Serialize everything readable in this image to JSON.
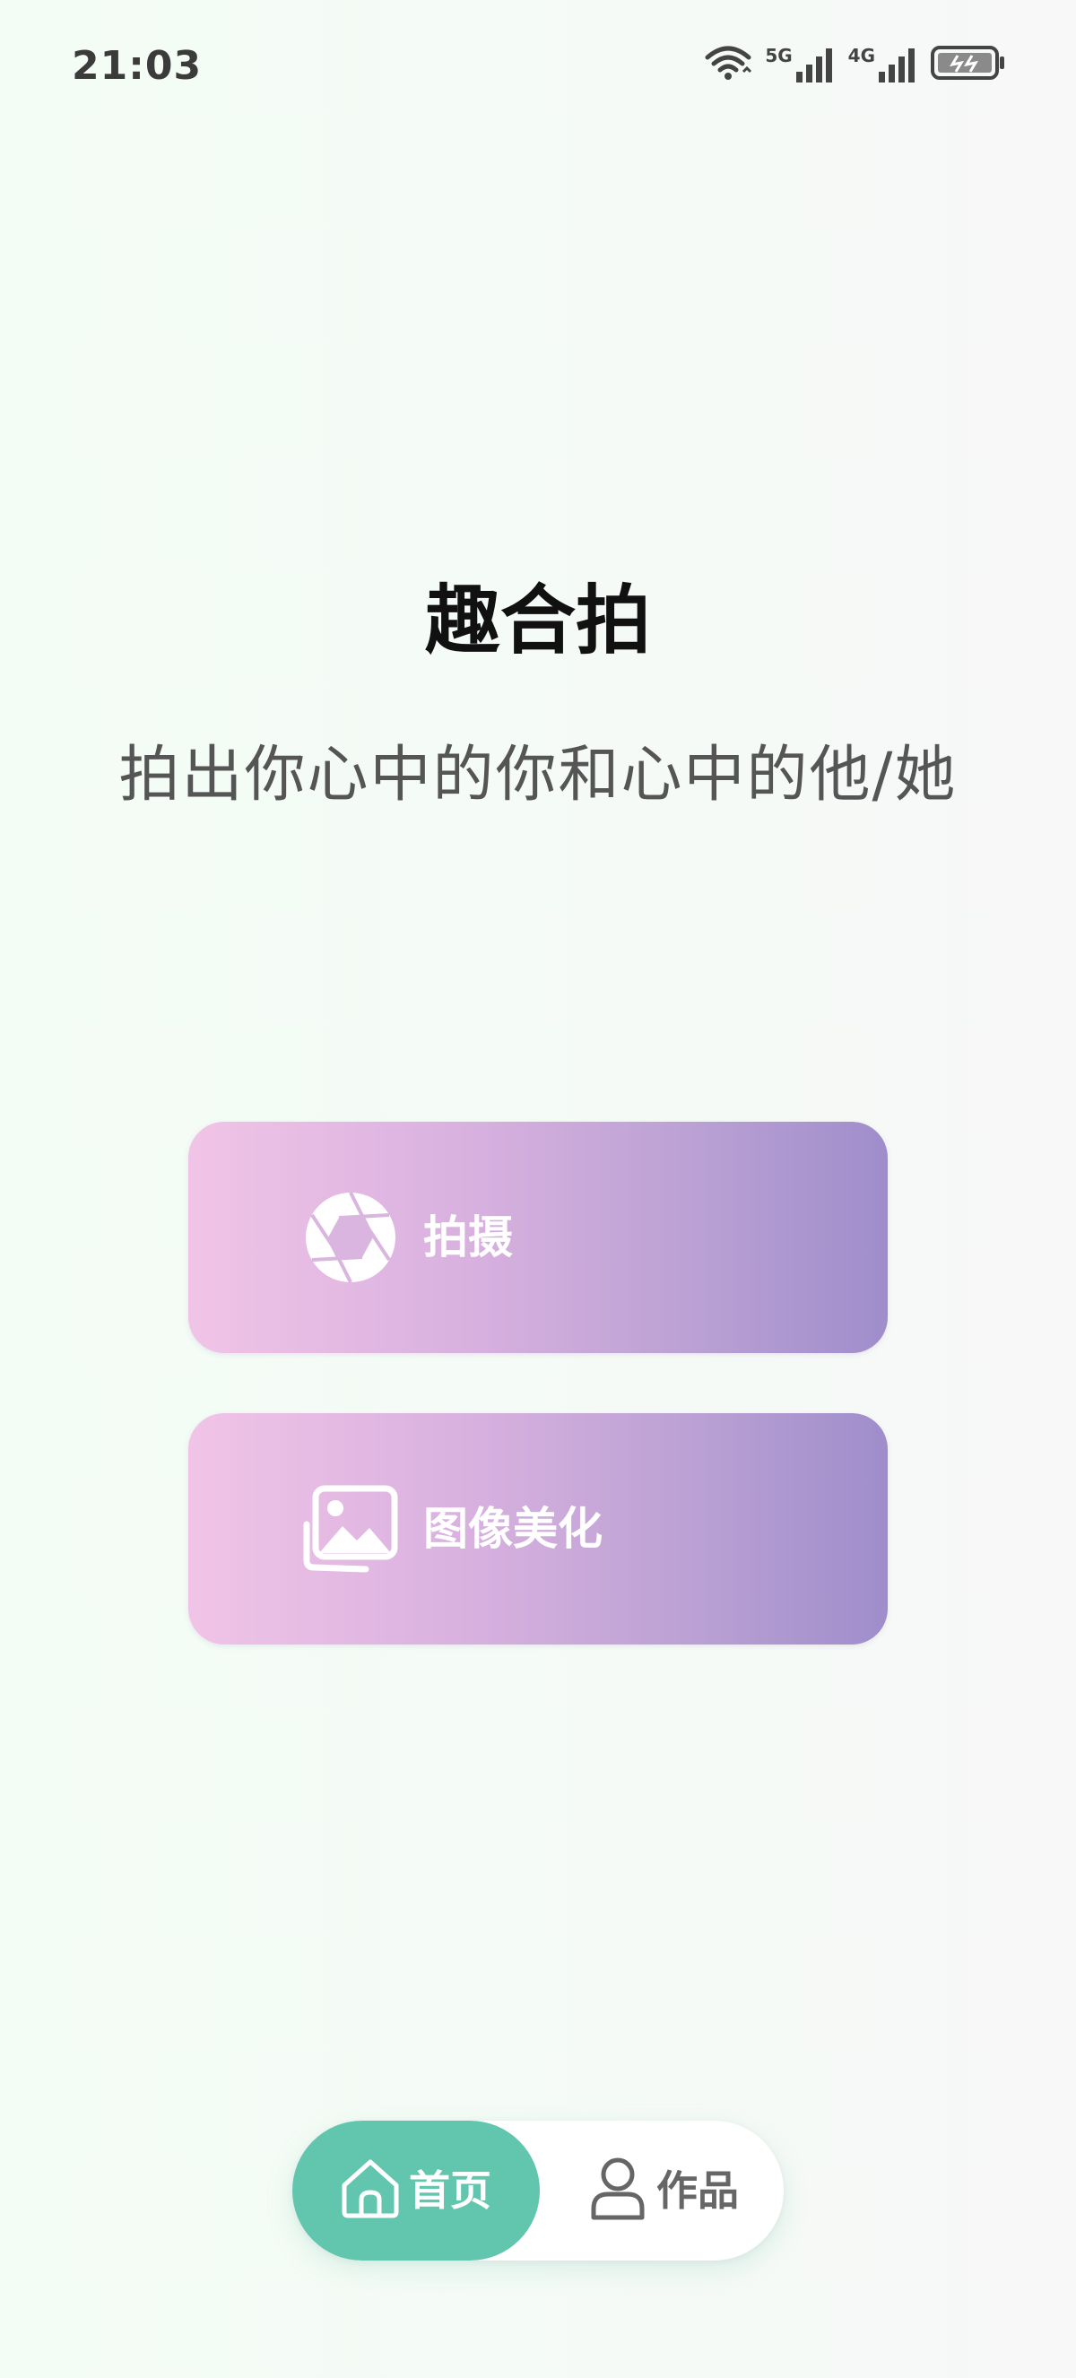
{
  "status_bar": {
    "time": "21:03",
    "signal_1_label": "5G",
    "signal_2_label": "4G",
    "icons": [
      "wifi-icon",
      "signal-5g-icon",
      "signal-4g-icon",
      "battery-charging-icon"
    ]
  },
  "header": {
    "title": "趣合拍",
    "subtitle": "拍出你心中的你和心中的他/她"
  },
  "actions": {
    "shoot_label": "拍摄",
    "shoot_icon": "camera-aperture-icon",
    "beautify_label": "图像美化",
    "beautify_icon": "image-gallery-icon"
  },
  "bottom_nav": {
    "home_label": "首页",
    "home_icon": "home-icon",
    "works_label": "作品",
    "works_icon": "user-icon",
    "active": "home"
  },
  "colors": {
    "accent_green": "#61c6ad",
    "button_gradient_start": "#f1c4e7",
    "button_gradient_end": "#9f8dcb"
  }
}
